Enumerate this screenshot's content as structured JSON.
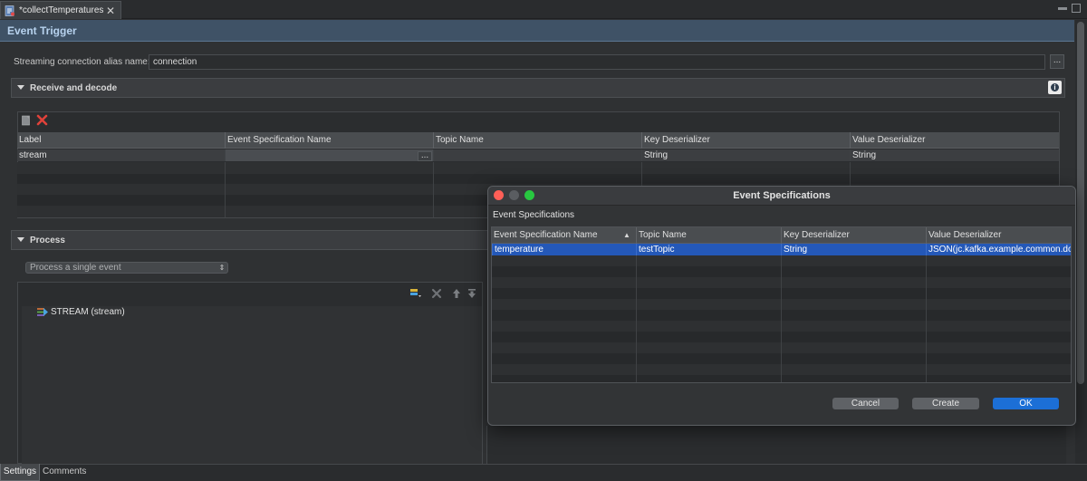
{
  "editor_tab": {
    "label": "*collectTemperatures",
    "icon": "file-icon",
    "close_icon": "close-icon"
  },
  "trigger": {
    "title": "Event Trigger"
  },
  "alias": {
    "label": "Streaming connection alias name:",
    "value": "connection",
    "browse_label": "..."
  },
  "receive": {
    "title": "Receive and decode",
    "info_glyph": "i",
    "columns": [
      "Label",
      "Event Specification Name",
      "Topic Name",
      "Key Deserializer",
      "Value Deserializer"
    ],
    "rows": [
      [
        "stream",
        "",
        "",
        "String",
        "String"
      ]
    ],
    "browse_label": "..."
  },
  "process": {
    "title": "Process",
    "mode": "Process a single event",
    "tree_item": "STREAM (stream)"
  },
  "dialog": {
    "title": "Event Specifications",
    "subtitle": "Event Specifications",
    "columns": [
      "Event Specification Name",
      "Topic Name",
      "Key Deserializer",
      "Value Deserializer"
    ],
    "rows": [
      [
        "temperature",
        "testTopic",
        "String",
        "JSON(jc.kafka.example.common.doc"
      ]
    ],
    "cancel_label": "Cancel",
    "create_label": "Create",
    "ok_label": "OK",
    "colors": {
      "selection": "#2458b8",
      "primary_button": "#1c6fd6",
      "close": "#ff5f57",
      "minimize": "#5a5d61",
      "zoom": "#28c840"
    }
  },
  "bottom_tabs": {
    "settings": "Settings",
    "comments": "Comments"
  }
}
